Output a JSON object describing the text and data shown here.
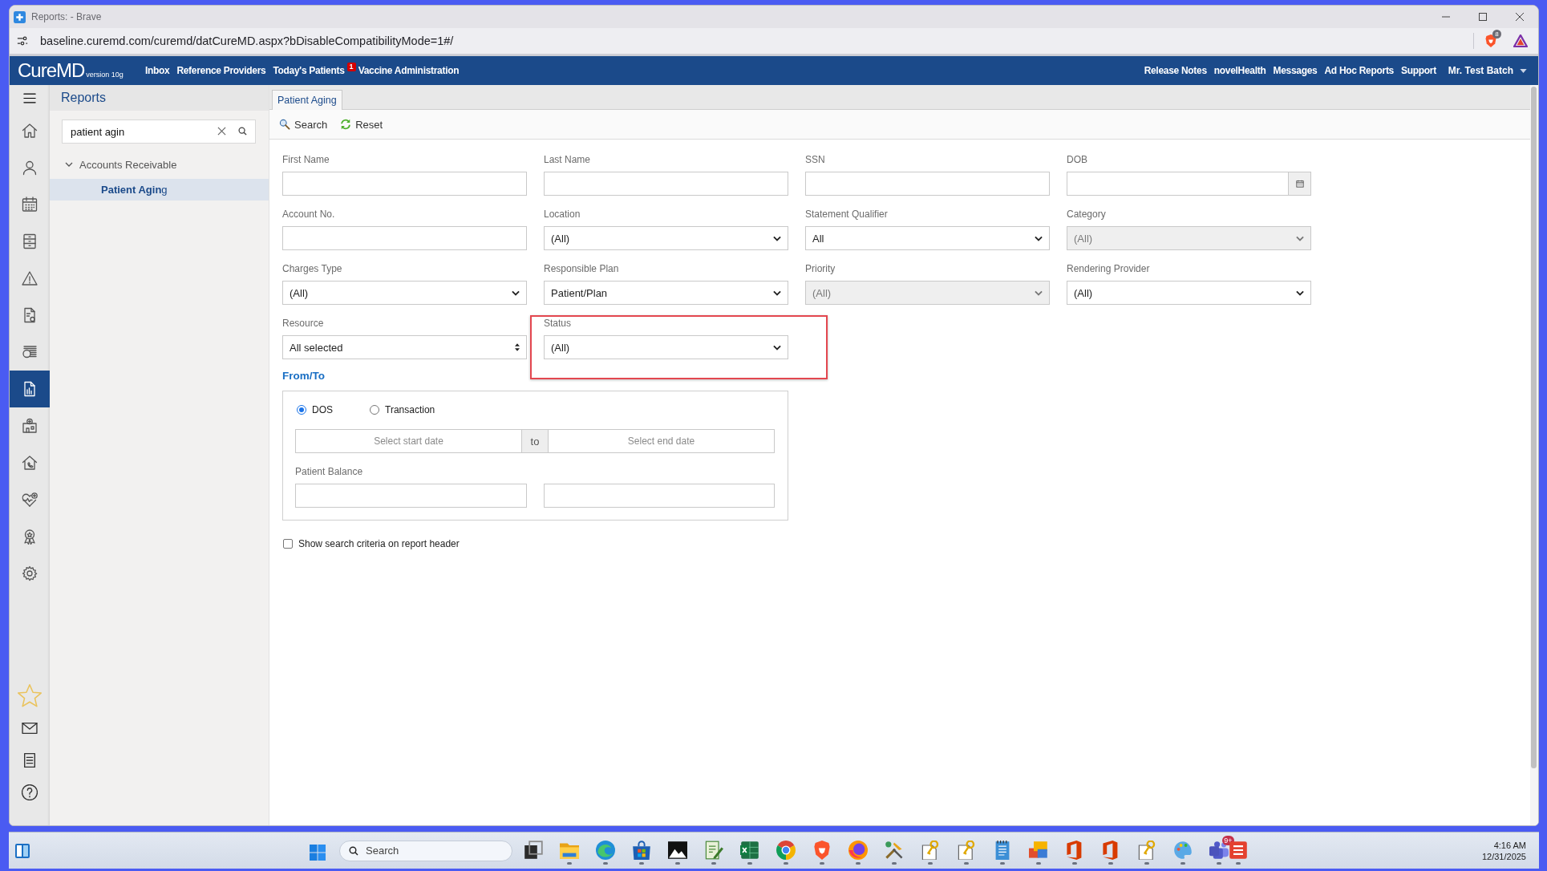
{
  "browser": {
    "title": "Reports: - Brave",
    "url": "baseline.curemd.com/curemd/datCureMD.aspx?bDisableCompatibilityMode=1#/",
    "shields_badge": "8"
  },
  "app_header": {
    "logo": "CureMD",
    "version": "version 10g",
    "nav_left": [
      {
        "label": "Inbox"
      },
      {
        "label": "Reference Providers"
      },
      {
        "label": "Today's Patients",
        "badge": "1"
      },
      {
        "label": "Vaccine Administration"
      }
    ],
    "nav_right": [
      {
        "label": "Release Notes"
      },
      {
        "label": "novelHealth"
      },
      {
        "label": "Messages"
      },
      {
        "label": "Ad Hoc Reports"
      },
      {
        "label": "Support"
      }
    ],
    "user": "Mr. Test Batch"
  },
  "rail": {
    "items": [
      {
        "kind": "home",
        "selected": false
      },
      {
        "kind": "user",
        "selected": false
      },
      {
        "kind": "calendar",
        "selected": false
      },
      {
        "kind": "cabinet",
        "selected": false
      },
      {
        "kind": "warning",
        "selected": false
      },
      {
        "kind": "bill",
        "selected": false
      },
      {
        "kind": "money",
        "selected": false
      },
      {
        "kind": "reports",
        "selected": true
      },
      {
        "kind": "hospital",
        "selected": false
      },
      {
        "kind": "house_phone",
        "selected": false
      },
      {
        "kind": "heart_plus",
        "selected": false
      },
      {
        "kind": "award",
        "selected": false
      },
      {
        "kind": "gear",
        "selected": false
      }
    ],
    "bottom_items": [
      {
        "kind": "star"
      },
      {
        "kind": "mail"
      },
      {
        "kind": "list"
      },
      {
        "kind": "help"
      }
    ]
  },
  "reports_panel": {
    "title": "Reports",
    "search": {
      "value": "patient agin"
    },
    "tree": [
      {
        "label": "Accounts Receivable",
        "expanded": true,
        "children": [
          {
            "label": "**Patient Agin**g",
            "selected": true
          }
        ]
      }
    ]
  },
  "tabs": [
    {
      "label": "Patient Aging",
      "selected": true
    }
  ],
  "toolbar": [
    {
      "kind": "search",
      "label": "Search"
    },
    {
      "kind": "reset",
      "label": "Reset"
    }
  ],
  "form": {
    "fields": [
      {
        "label": "First Name",
        "kind": "text",
        "disabled": false,
        "highlighted": false
      },
      {
        "label": "Last Name",
        "kind": "text",
        "disabled": false,
        "highlighted": false
      },
      {
        "label": "SSN",
        "kind": "text",
        "disabled": false,
        "highlighted": false
      },
      {
        "label": "DOB",
        "kind": "date",
        "disabled": false,
        "highlighted": false
      },
      {
        "label": "Account No.",
        "kind": "text",
        "disabled": false,
        "highlighted": false
      },
      {
        "label": "Location",
        "kind": "select",
        "value": "(All)",
        "disabled": false,
        "highlighted": false
      },
      {
        "label": "Statement Qualifier",
        "kind": "select",
        "value": "All",
        "disabled": false,
        "highlighted": false
      },
      {
        "label": "Category",
        "kind": "select",
        "value": "(All)",
        "disabled": true,
        "highlighted": false
      },
      {
        "label": "Charges Type",
        "kind": "select",
        "value": "(All)",
        "disabled": false,
        "highlighted": false
      },
      {
        "label": "Responsible Plan",
        "kind": "select",
        "value": "Patient/Plan",
        "disabled": false,
        "highlighted": false
      },
      {
        "label": "Priority",
        "kind": "select",
        "value": "(All)",
        "disabled": true,
        "highlighted": false
      },
      {
        "label": "Rendering Provider",
        "kind": "select",
        "value": "(All)",
        "disabled": false,
        "highlighted": false
      },
      {
        "label": "Resource",
        "kind": "multiselect",
        "value": "All selected",
        "disabled": false,
        "highlighted": false
      },
      {
        "label": "Status",
        "kind": "select",
        "value": "(All)",
        "disabled": false,
        "highlighted": true
      }
    ],
    "from_to": {
      "title": "From/To",
      "options": [
        {
          "label": "DOS",
          "selected": true
        },
        {
          "label": "Transaction",
          "selected": false
        }
      ],
      "start": {
        "placeholder": "Select start date"
      },
      "separator": "to",
      "end": {
        "placeholder": "Select end date"
      },
      "balance_label": "Patient Balance"
    },
    "show_criteria": {
      "label": "Show search criteria on report header",
      "checked": false
    }
  },
  "taskbar": {
    "search": {
      "placeholder": "Search"
    },
    "apps": [
      {
        "kind": "taskview",
        "running": false
      },
      {
        "kind": "folder",
        "running": true
      },
      {
        "kind": "edge",
        "running": true
      },
      {
        "kind": "store",
        "running": true
      },
      {
        "kind": "photos",
        "running": true
      },
      {
        "kind": "notepad_green",
        "running": true
      },
      {
        "kind": "excel",
        "running": true
      },
      {
        "kind": "chrome",
        "running": true
      },
      {
        "kind": "brave",
        "running": true
      },
      {
        "kind": "firefox",
        "running": true
      },
      {
        "kind": "tools",
        "running": true
      },
      {
        "kind": "keyfile",
        "running": true
      },
      {
        "kind": "keyfile",
        "running": true
      },
      {
        "kind": "notes",
        "running": true
      },
      {
        "kind": "tiles",
        "running": true
      },
      {
        "kind": "office",
        "running": true
      },
      {
        "kind": "office",
        "running": true
      },
      {
        "kind": "keyfile",
        "running": true
      },
      {
        "kind": "paint",
        "running": true
      },
      {
        "kind": "teams",
        "running": true,
        "badge": "9+"
      },
      {
        "kind": "tile",
        "running": true
      }
    ],
    "time": "4:16 AM",
    "date": "12/31/2025"
  }
}
